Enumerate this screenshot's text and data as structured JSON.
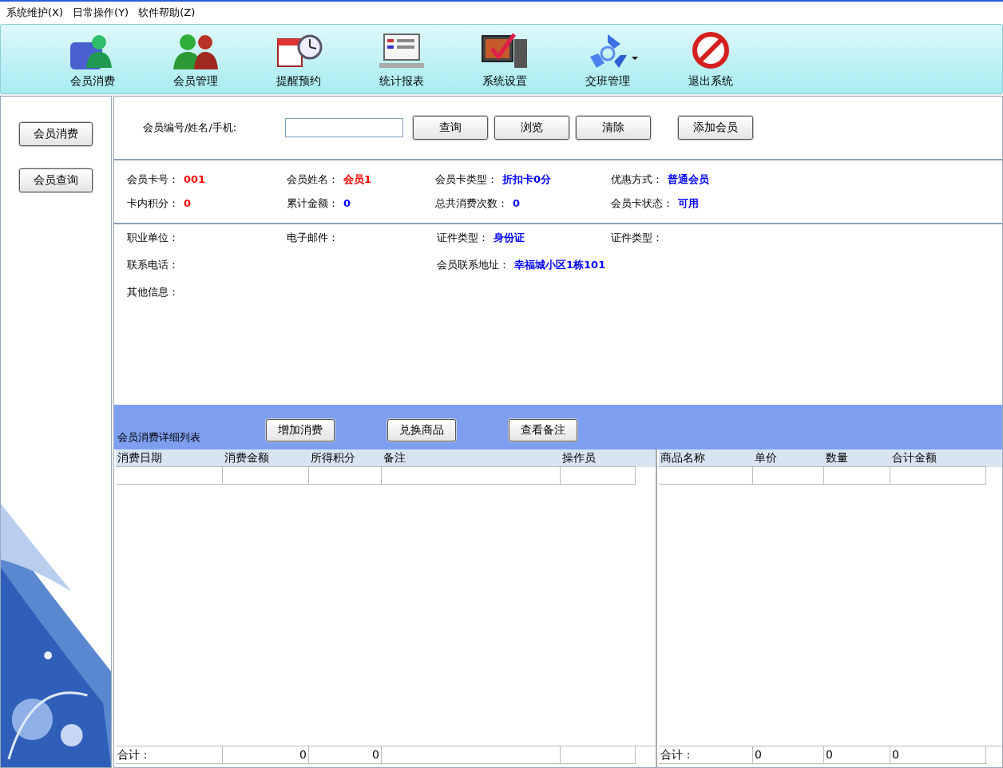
{
  "menu": [
    "系统维护(X)",
    "日常操作(Y)",
    "软件帮助(Z)"
  ],
  "toolbar": [
    {
      "label": "会员消费",
      "dropdown": false
    },
    {
      "label": "会员管理",
      "dropdown": false
    },
    {
      "label": "提醒预约",
      "dropdown": false
    },
    {
      "label": "统计报表",
      "dropdown": false
    },
    {
      "label": "系统设置",
      "dropdown": false
    },
    {
      "label": "交班管理",
      "dropdown": true
    },
    {
      "label": "退出系统",
      "dropdown": false
    }
  ],
  "sidebar": {
    "buttons": [
      "会员消费",
      "会员查询"
    ],
    "kind": "picture"
  },
  "search": {
    "label": "会员编号/姓名/手机:",
    "buttons": [
      "查询",
      "浏览",
      "清除",
      "添加会员"
    ]
  },
  "card_info": [
    {
      "label": "会员卡号：",
      "value": "001",
      "color": "#ff0000"
    },
    {
      "label": "会员姓名：",
      "value": "会员1",
      "color": "#ff0000"
    },
    {
      "label": "会员卡类型：",
      "value": "折扣卡0分",
      "color": "#0000ff"
    },
    {
      "label": "优惠方式：",
      "value": "普通会员",
      "color": "#0000ff"
    },
    {
      "label": "卡内积分：",
      "value": "0",
      "color": "#ff0000"
    },
    {
      "label": "累计金额：",
      "value": "0",
      "color": "#0000ff"
    },
    {
      "label": "总共消费次数：",
      "value": "0",
      "color": "#0000ff"
    },
    {
      "label": "会员卡状态：",
      "value": "可用",
      "color": "#0000ff"
    }
  ],
  "details": [
    [
      {
        "label": "职业单位："
      },
      {
        "label": "电子邮件："
      },
      {
        "label": "证件类型：",
        "value": "身份证"
      },
      {
        "label": "证件类型："
      }
    ],
    [
      {
        "label": "联系电话："
      },
      {
        "label": "会员联系地址：",
        "value": "幸福城小区1栋101"
      }
    ],
    [
      {
        "label": "其他信息："
      }
    ]
  ],
  "detail_bar": {
    "title": "会员消费详细列表",
    "buttons": [
      "增加消费",
      "兑换商品",
      "查看备注"
    ]
  },
  "consumption_table": {
    "columns": [
      "消费日期",
      "消费金额",
      "所得积分",
      "备注",
      "操作员"
    ],
    "totals": [
      "合计：",
      "0",
      "0"
    ]
  },
  "goods_table": {
    "columns": [
      "商品名称",
      "单价",
      "数量",
      "合计金额"
    ],
    "totals": [
      "合计：",
      "0",
      "0",
      "0"
    ]
  }
}
